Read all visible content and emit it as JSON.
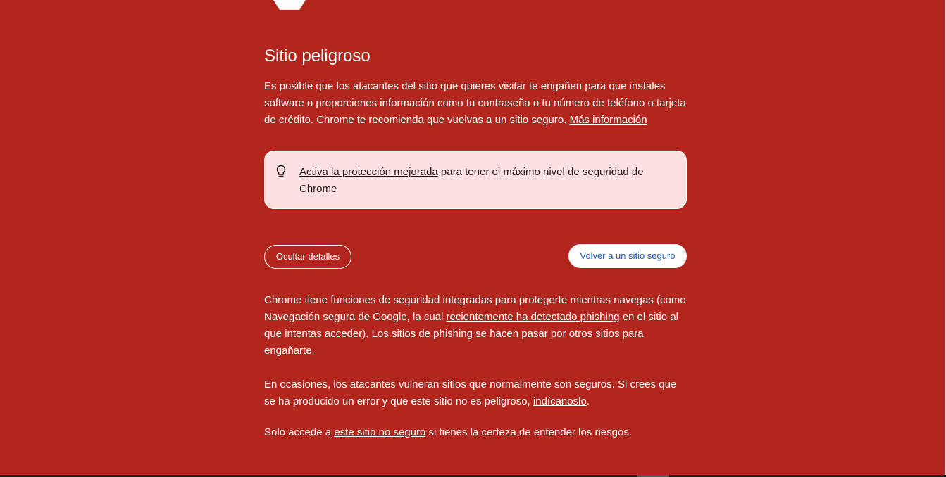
{
  "heading": "Sitio peligroso",
  "intro": {
    "text": "Es posible que los atacantes del sitio que quieres visitar te engañen para que instales software o proporciones información como tu contraseña o tu número de teléfono o tarjeta de crédito. Chrome te recomienda que vuelvas a un sitio seguro. ",
    "link": "Más información"
  },
  "callout": {
    "icon": "lightbulb-icon",
    "link": "Activa la protección mejorada",
    "text": " para tener el máximo nivel de seguridad de Chrome"
  },
  "buttons": {
    "details": "Ocultar detalles",
    "back": "Volver a un sitio seguro"
  },
  "details": {
    "p1_before": "Chrome tiene funciones de seguridad integradas para protegerte mientras navegas (como Navegación segura de Google, la cual ",
    "p1_link": "recientemente ha detectado phishing",
    "p1_after": " en el sitio al que intentas acceder). Los sitios de phishing se hacen pasar por otros sitios para engañarte.",
    "p2_before": "En ocasiones, los atacantes vulneran sitios que normalmente son seguros. Si crees que se ha producido un error y que este sitio no es peligroso, ",
    "p2_link": "indícanoslo",
    "p2_after": ".",
    "p3_before": "Solo accede a ",
    "p3_link": "este sitio no seguro",
    "p3_after": " si tienes la certeza de entender los riesgos."
  },
  "colors": {
    "background": "#b3261e",
    "callout_bg": "#fbe2e0",
    "link_button_text": "#1a56b5"
  }
}
